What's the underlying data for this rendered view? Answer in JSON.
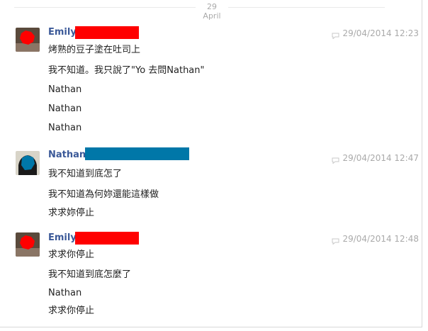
{
  "date_divider": "29 April",
  "colors": {
    "sender_name": "#3b5998",
    "redact_emily": "#ff0000",
    "redact_nathan": "#0077a8",
    "timestamp": "#aaaaaa"
  },
  "groups": [
    {
      "sender": "Emily",
      "timestamp": "29/04/2014 12:23",
      "messages": [
        "烤熟的豆子塗在吐司上",
        "我不知道。我只說了\"Yo 去問Nathan\"",
        "Nathan",
        "Nathan",
        "Nathan"
      ]
    },
    {
      "sender": "Nathan",
      "timestamp": "29/04/2014 12:47",
      "messages": [
        "我不知道到底怎了",
        "我不知道為何妳還能這樣做",
        "求求妳停止"
      ]
    },
    {
      "sender": "Emily",
      "timestamp": "29/04/2014 12:48",
      "messages": [
        "求求你停止",
        "我不知道到底怎麼了",
        "Nathan",
        "求求你停止"
      ]
    }
  ]
}
